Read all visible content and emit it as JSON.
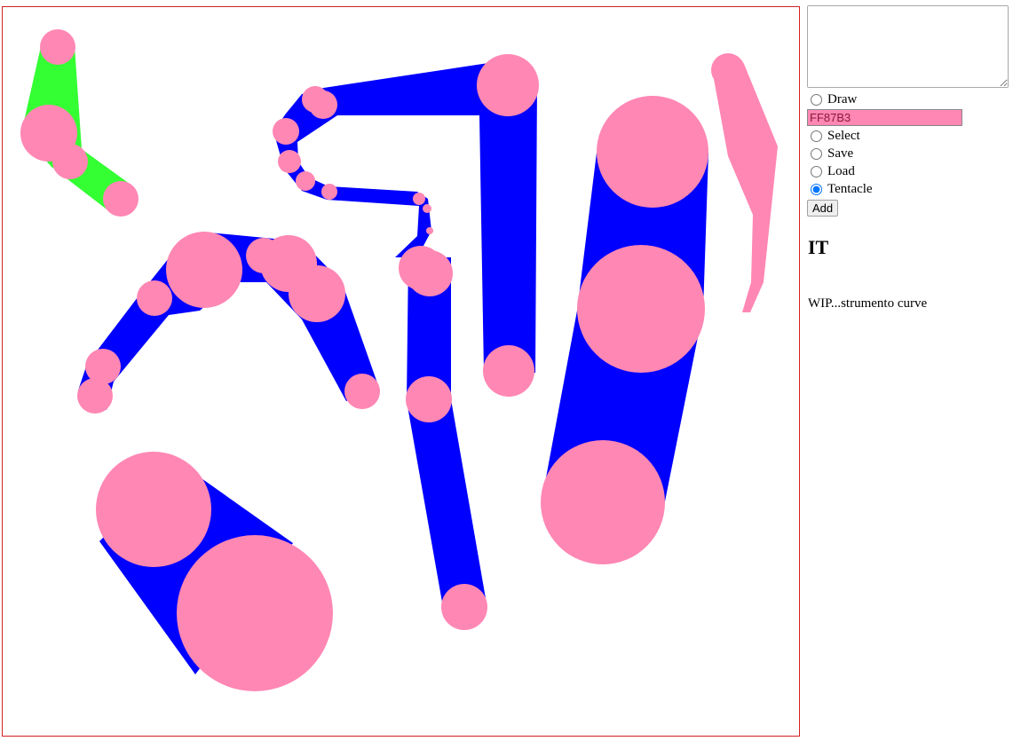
{
  "toolbar": {
    "textarea_value": "",
    "color_value": "FF87B3",
    "modes": [
      {
        "id": "draw",
        "label": "Draw",
        "checked": false
      },
      {
        "id": "select",
        "label": "Select",
        "checked": false
      },
      {
        "id": "save",
        "label": "Save",
        "checked": false
      },
      {
        "id": "load",
        "label": "Load",
        "checked": false
      },
      {
        "id": "tentacle",
        "label": "Tentacle",
        "checked": true
      }
    ],
    "add_label": "Add"
  },
  "language_heading": "IT",
  "status_text": "WIP...strumento curve",
  "colors": {
    "canvas_border": "#d42020",
    "tentacle_body": "#0000ff",
    "tentacle_body_alt": "#33ff33",
    "joint": "#ff87b3"
  }
}
